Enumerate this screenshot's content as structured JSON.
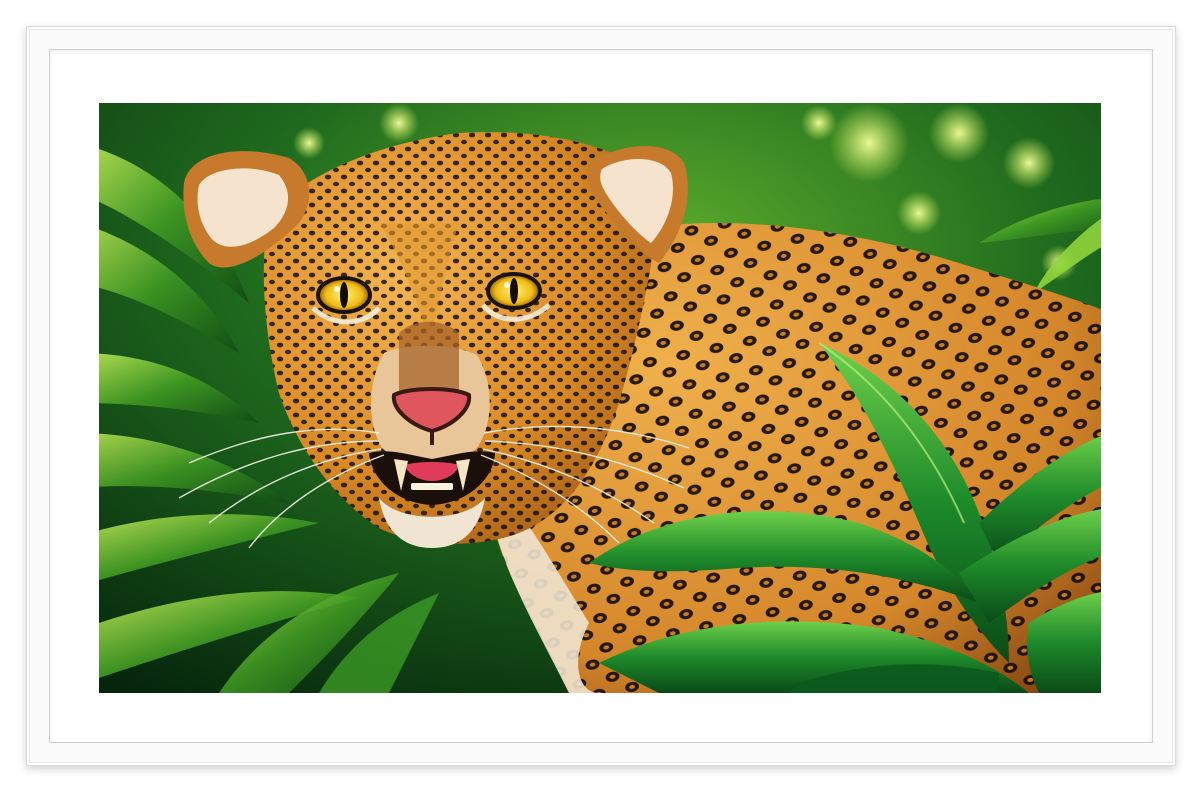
{
  "image": {
    "subject": "leopard-icon",
    "colors": {
      "frame": "#fbfbfb",
      "mat": "#ffffff",
      "jungle_dark": "#0d3a14",
      "jungle_mid": "#2f8a2a",
      "jungle_light": "#b6e04a",
      "fur": "#e0962e",
      "spot": "#1b1109",
      "eye": "#f4c21a"
    }
  }
}
